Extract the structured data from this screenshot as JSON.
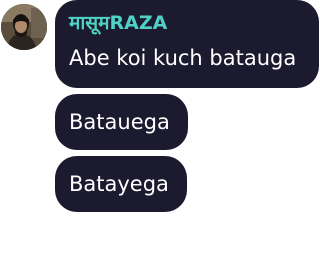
{
  "colors": {
    "bubble_background": "#1b1a2e",
    "sender_name": "#4fd1c5",
    "message_text": "#ffffff",
    "page_background": "#ffffff"
  },
  "group": {
    "sender": {
      "name": "मासूमRAZA",
      "avatar_icon": "user-avatar-photo"
    },
    "messages": [
      {
        "text": "Abe koi kuch batauga"
      },
      {
        "text": "Batauega"
      },
      {
        "text": "Batayega"
      }
    ]
  }
}
